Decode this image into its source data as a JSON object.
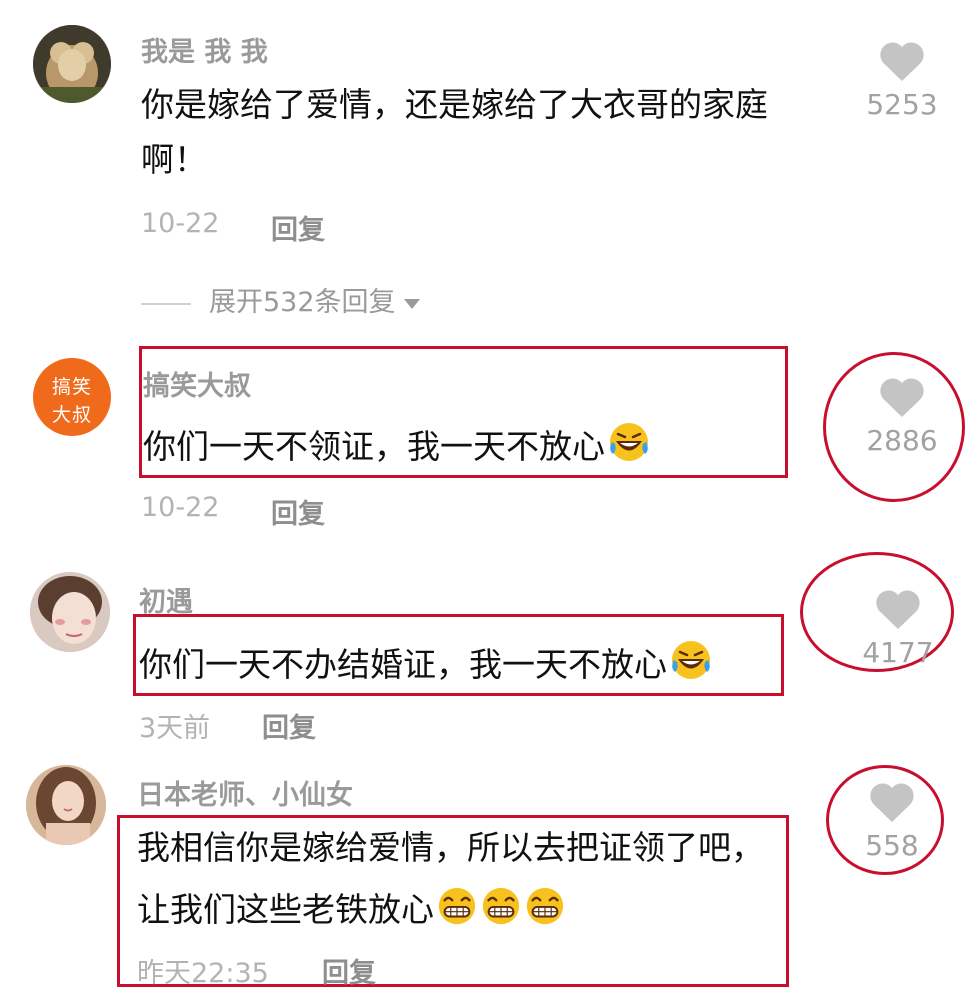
{
  "comments": [
    {
      "username": "我是 我 我",
      "text_lines": [
        "你是嫁给了爱情，还是嫁给了大衣哥的家庭",
        "啊！"
      ],
      "date": "10-22",
      "reply_label": "回复",
      "likes": "5253",
      "expand_replies": "展开532条回复"
    },
    {
      "username": "搞笑大叔",
      "avatar_text": [
        "搞笑",
        "大叔"
      ],
      "text": "你们一天不领证，我一天不放心",
      "emoji_icons": [
        "laughing-crying-emoji-icon"
      ],
      "date": "10-22",
      "reply_label": "回复",
      "likes": "2886"
    },
    {
      "username": "初遇",
      "text": "你们一天不办结婚证，我一天不放心",
      "emoji_icons": [
        "laughing-crying-emoji-icon"
      ],
      "date": "3天前",
      "reply_label": "回复",
      "likes": "4177"
    },
    {
      "username": "日本老师、小仙女",
      "text_lines": [
        "我相信你是嫁给爱情，所以去把证领了吧，",
        "让我们这些老铁放心"
      ],
      "emoji_icons": [
        "grinning-emoji-icon",
        "grinning-emoji-icon",
        "grinning-emoji-icon"
      ],
      "date": "昨天22:35",
      "reply_label": "回复",
      "likes": "558"
    }
  ],
  "colors": {
    "highlight": "#c8102e",
    "avatar_orange": "#f06a1c",
    "muted_text": "#9a9a9a",
    "body_text": "#111111"
  },
  "icons": [
    "heart-icon",
    "chevron-down-icon"
  ]
}
